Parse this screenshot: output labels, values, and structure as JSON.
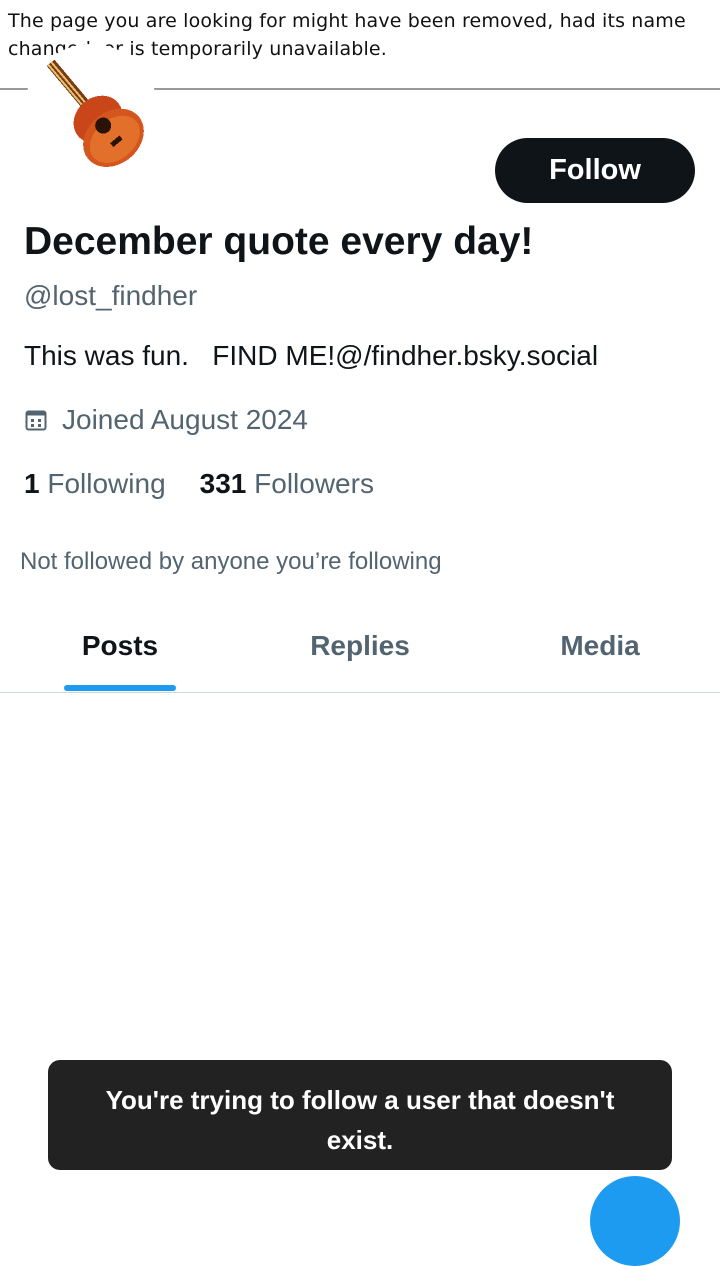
{
  "error_banner": {
    "message": "The page you are looking for might have been removed, had its name changed, or is temporarily unavailable."
  },
  "profile": {
    "display_name": "December quote every day!",
    "handle": "@lost_findher",
    "bio": "This was fun.   FIND ME!@/findher.bsky.social",
    "joined": "Joined August 2024",
    "following_count": "1",
    "following_label": "Following",
    "followers_count": "331",
    "followers_label": "Followers",
    "mutual_note": "Not followed by anyone you’re following",
    "avatar_icon": "guitar-icon"
  },
  "actions": {
    "follow_label": "Follow"
  },
  "tabs": [
    {
      "label": "Posts",
      "active": true
    },
    {
      "label": "Replies",
      "active": false
    },
    {
      "label": "Media",
      "active": false
    }
  ],
  "toast": {
    "message": "You're trying to follow a user that doesn't exist."
  },
  "colors": {
    "accent": "#1d9bf0",
    "text_primary": "#0f1419",
    "text_secondary": "#536471",
    "button_dark": "#0f1419",
    "toast_bg": "#222222"
  }
}
